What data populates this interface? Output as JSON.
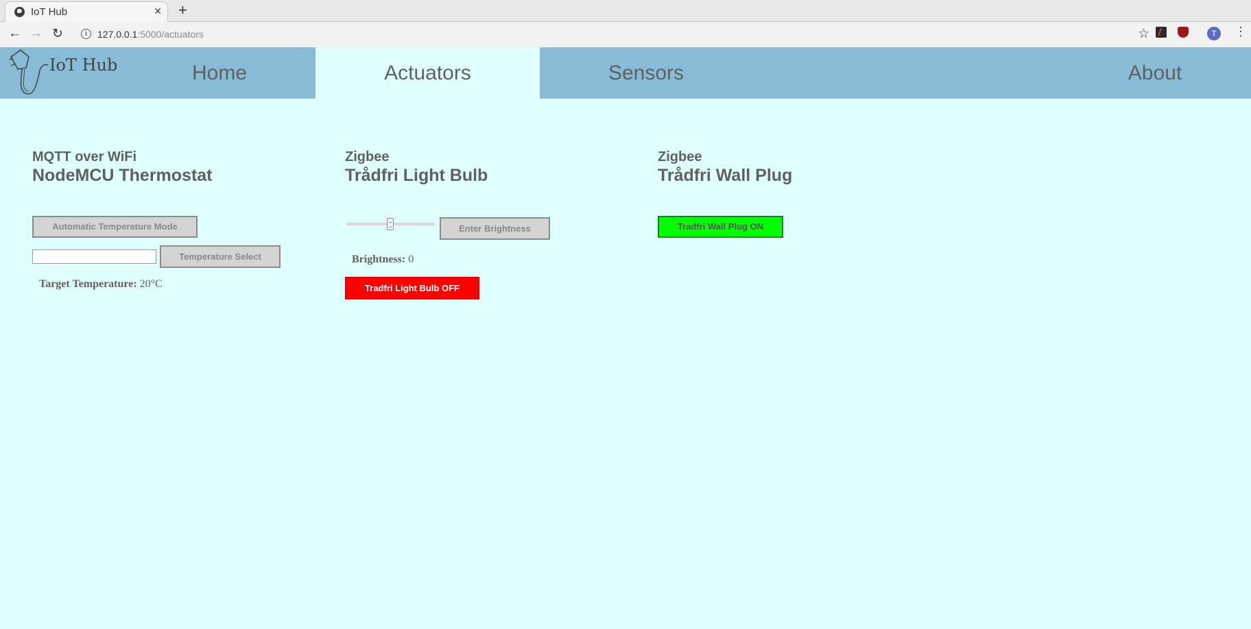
{
  "browser": {
    "tab_title": "IoT Hub",
    "close_glyph": "✕",
    "new_tab_glyph": "+",
    "back_glyph": "←",
    "forward_glyph": "→",
    "reload_glyph": "↻",
    "url_host": "127.0.0.1",
    "url_path": ":5000/actuators",
    "star_glyph": "☆",
    "avatar_letter": "T",
    "menu_glyph": "⋮"
  },
  "header": {
    "logo_text": "IoT Hub",
    "nav": [
      {
        "label": "Home"
      },
      {
        "label": "Actuators"
      },
      {
        "label": "Sensors"
      },
      {
        "label": "About"
      }
    ]
  },
  "thermostat": {
    "protocol": "MQTT over WiFi",
    "device": "NodeMCU Thermostat",
    "auto_button": "Automatic Temperature Mode",
    "temp_input_value": "",
    "temp_select_button": "Temperature Select",
    "target_label": "Target Temperature:",
    "target_value": " 20°C"
  },
  "light_bulb": {
    "protocol": "Zigbee",
    "device": "Trådfri Light Bulb",
    "brightness_button": "Enter Brightness",
    "brightness_label": "Brightness:",
    "brightness_value": " 0",
    "toggle_button": "Tradfri Light Bulb OFF",
    "toggle_color": "#ff0000"
  },
  "wall_plug": {
    "protocol": "Zigbee",
    "device": "Trådfri Wall Plug",
    "toggle_button": "Tradfri Wall Plug ON",
    "toggle_color": "#00ff00"
  },
  "colors": {
    "page_background": "#dfffff",
    "nav_background": "#87bbd6",
    "text_gray": "#606060"
  },
  "icons": [
    "globe-icon",
    "info-icon",
    "star-icon",
    "extension-icon",
    "shield-icon",
    "plug-logo-icon"
  ]
}
